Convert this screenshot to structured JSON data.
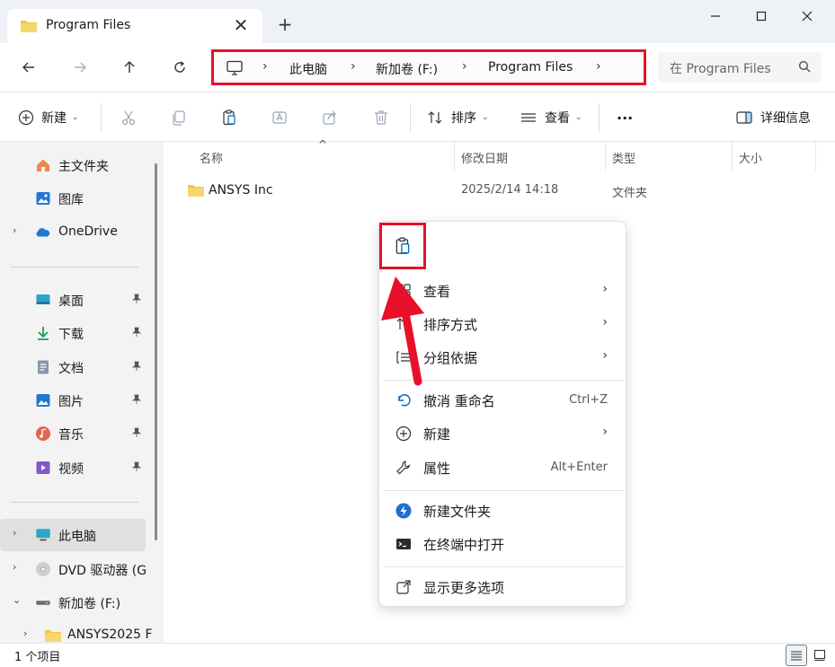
{
  "window": {
    "tab_title": "Program Files",
    "tab_close": "✕",
    "new_tab": "+"
  },
  "address": {
    "crumbs": [
      "此电脑",
      "新加卷 (F:)",
      "Program Files"
    ],
    "separator": "›"
  },
  "search": {
    "placeholder": "在 Program Files"
  },
  "toolbar": {
    "new_label": "新建",
    "sort_label": "排序",
    "view_label": "查看",
    "more_label": "···",
    "details_label": "详细信息",
    "chevron": "⌄"
  },
  "sidebar": {
    "items": [
      {
        "label": "主文件夹"
      },
      {
        "label": "图库"
      },
      {
        "label": "OneDrive"
      },
      {
        "label": "桌面"
      },
      {
        "label": "下载"
      },
      {
        "label": "文档"
      },
      {
        "label": "图片"
      },
      {
        "label": "音乐"
      },
      {
        "label": "视频"
      },
      {
        "label": "此电脑"
      },
      {
        "label": "DVD 驱动器 (G"
      },
      {
        "label": "新加卷 (F:)"
      },
      {
        "label": "ANSYS2025 F"
      }
    ],
    "expander_collapsed": "›",
    "expander_expanded": "⌄"
  },
  "columns": {
    "name": "名称",
    "date": "修改日期",
    "type": "类型",
    "size": "大小",
    "sort_caret": "^"
  },
  "files": [
    {
      "name": "ANSYS Inc",
      "date": "2025/2/14 14:18",
      "type": "文件夹"
    }
  ],
  "status": {
    "count": "1 个项目"
  },
  "context_menu": {
    "items": [
      {
        "label": "查看",
        "arrow": "›"
      },
      {
        "label": "排序方式",
        "arrow": "›"
      },
      {
        "label": "分组依据",
        "arrow": "›"
      },
      {
        "label": "撤消 重命名",
        "shortcut": "Ctrl+Z"
      },
      {
        "label": "新建",
        "arrow": "›"
      },
      {
        "label": "属性",
        "shortcut": "Alt+Enter"
      },
      {
        "label": "新建文件夹"
      },
      {
        "label": "在终端中打开"
      },
      {
        "label": "显示更多选项"
      }
    ]
  },
  "colors": {
    "highlight_red": "#e8102a",
    "accent_blue": "#0067c0",
    "folder_yellow": "#f5c343"
  }
}
